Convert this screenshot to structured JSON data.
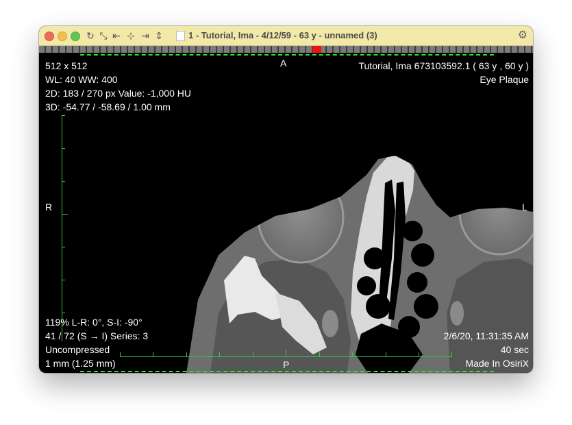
{
  "window": {
    "title": "1 - Tutorial, Ima - 4/12/59 - 63 y - unnamed (3)"
  },
  "toolbar": {
    "icons": [
      "rotate-icon",
      "fit-icon",
      "first-image-icon",
      "center-icon",
      "last-image-icon",
      "flip-icon"
    ],
    "glyphs": [
      "↻",
      "⤡",
      "⇤",
      "⊹",
      "⇥",
      "⇕"
    ]
  },
  "colors": {
    "titlebar": "#f2e9a8",
    "overlay_lines": "#2ee02e",
    "slider_thumb": "#ee1111"
  },
  "overlay": {
    "top_left": [
      "512 x 512",
      "WL: 40 WW: 400",
      "2D: 183 / 270 px Value: -1,000 HU",
      "3D: -54.77 / -58.69 / 1.00 mm"
    ],
    "top_right": [
      "Tutorial, Ima 673103592.1 (  63 y ,  60 y )",
      "Eye Plaque"
    ],
    "bottom_left": [
      "119% L-R: 0°, S-I: -90°",
      "41 / 72  (S → I) Series:  3",
      "Uncompressed",
      "1 mm (1.25 mm)"
    ],
    "bottom_right": [
      "2/6/20, 11:31:35 AM",
      "40 sec",
      "Made In OsiriX"
    ],
    "orientation": {
      "top": "A",
      "bottom": "P",
      "left": "R",
      "right": "L"
    }
  }
}
